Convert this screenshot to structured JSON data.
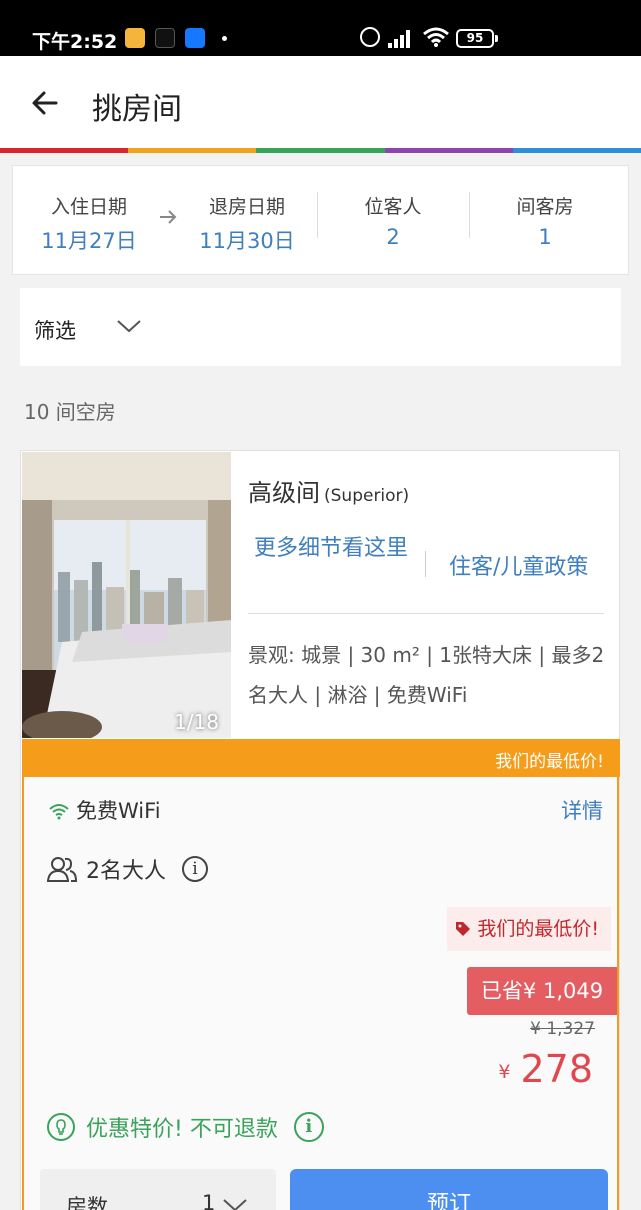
{
  "status_bar": {
    "time": "下午2:52",
    "battery": "95"
  },
  "header": {
    "title": "挑房间"
  },
  "colors": {
    "accent_blue": "#3f7fbf",
    "orange": "#f59d1a",
    "sale_red": "#e35d61",
    "deal_green": "#3aa35b",
    "book_button": "#4c8ff0",
    "rainbow": [
      "#d8262c",
      "#f0a31c",
      "#3aa35b",
      "#8e44ad",
      "#2d8fd5"
    ]
  },
  "dates": {
    "checkin_label": "入住日期",
    "checkin_value": "11月27日",
    "checkout_label": "退房日期",
    "checkout_value": "11月30日",
    "guests_label": "位客人",
    "guests_value": "2",
    "rooms_label": "间客房",
    "rooms_value": "1"
  },
  "filter": {
    "label": "筛选"
  },
  "availability": "10 间空房",
  "room": {
    "name": "高级间",
    "name_en": "(Superior)",
    "image_counter": "1/18",
    "details_link": "更多细节看这里",
    "policy_link": "住客/儿童政策",
    "description": "景观: 城景 | 30 m² | 1张特大床 | 最多2名大人 | 淋浴 | 免费WiFi"
  },
  "offer": {
    "banner": "我们的最低价!",
    "wifi": "免费WiFi",
    "details": "详情",
    "guests": "2名大人",
    "lowest_tag": "我们的最低价!",
    "saved": "已省¥ 1,049",
    "original_price": "¥ 1,327",
    "currency": "¥",
    "price": "278",
    "deal_text": "优惠特价! 不可退款",
    "rooms_label": "房数",
    "rooms_value": "1",
    "book_label": "预订"
  }
}
